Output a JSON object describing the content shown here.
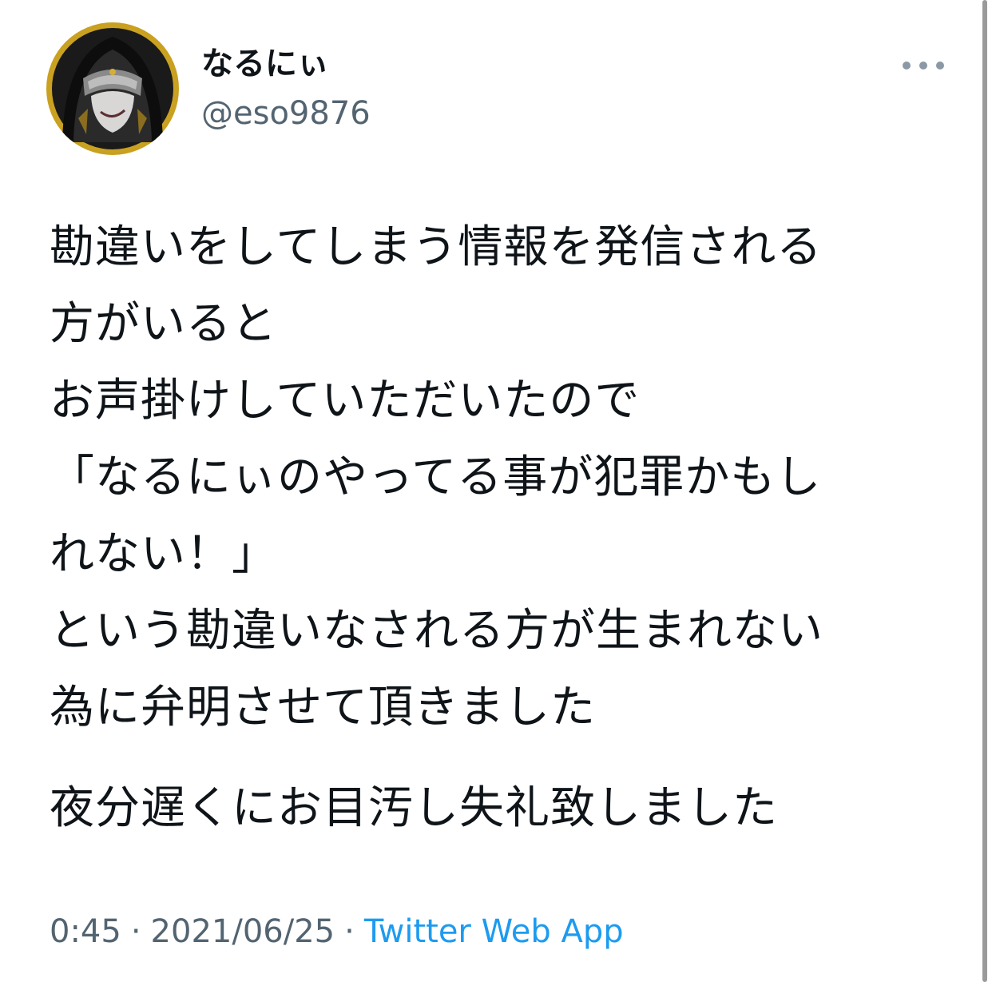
{
  "author": {
    "display_name": "なるにぃ",
    "handle": "@eso9876",
    "avatar_icon": "avatar-hooded-figure-icon"
  },
  "menu": {
    "icon": "more-options-icon"
  },
  "tweet": {
    "lines": [
      "勘違いをしてしまう情報を発信される",
      "方がいると",
      "お声掛けしていただいたので",
      "「なるにぃのやってる事が犯罪かもし",
      "れない！」",
      "という勘違いなされる方が生まれない",
      "為に弁明させて頂きました"
    ],
    "closing": "夜分遅くにお目汚し失礼致しました"
  },
  "meta": {
    "time": "0:45",
    "separator": "·",
    "date": "2021/06/25",
    "source": "Twitter Web App"
  },
  "colors": {
    "text": "#0f1419",
    "secondary": "#536471",
    "link": "#1d9bf0",
    "avatar_ring": "#c9a020"
  }
}
